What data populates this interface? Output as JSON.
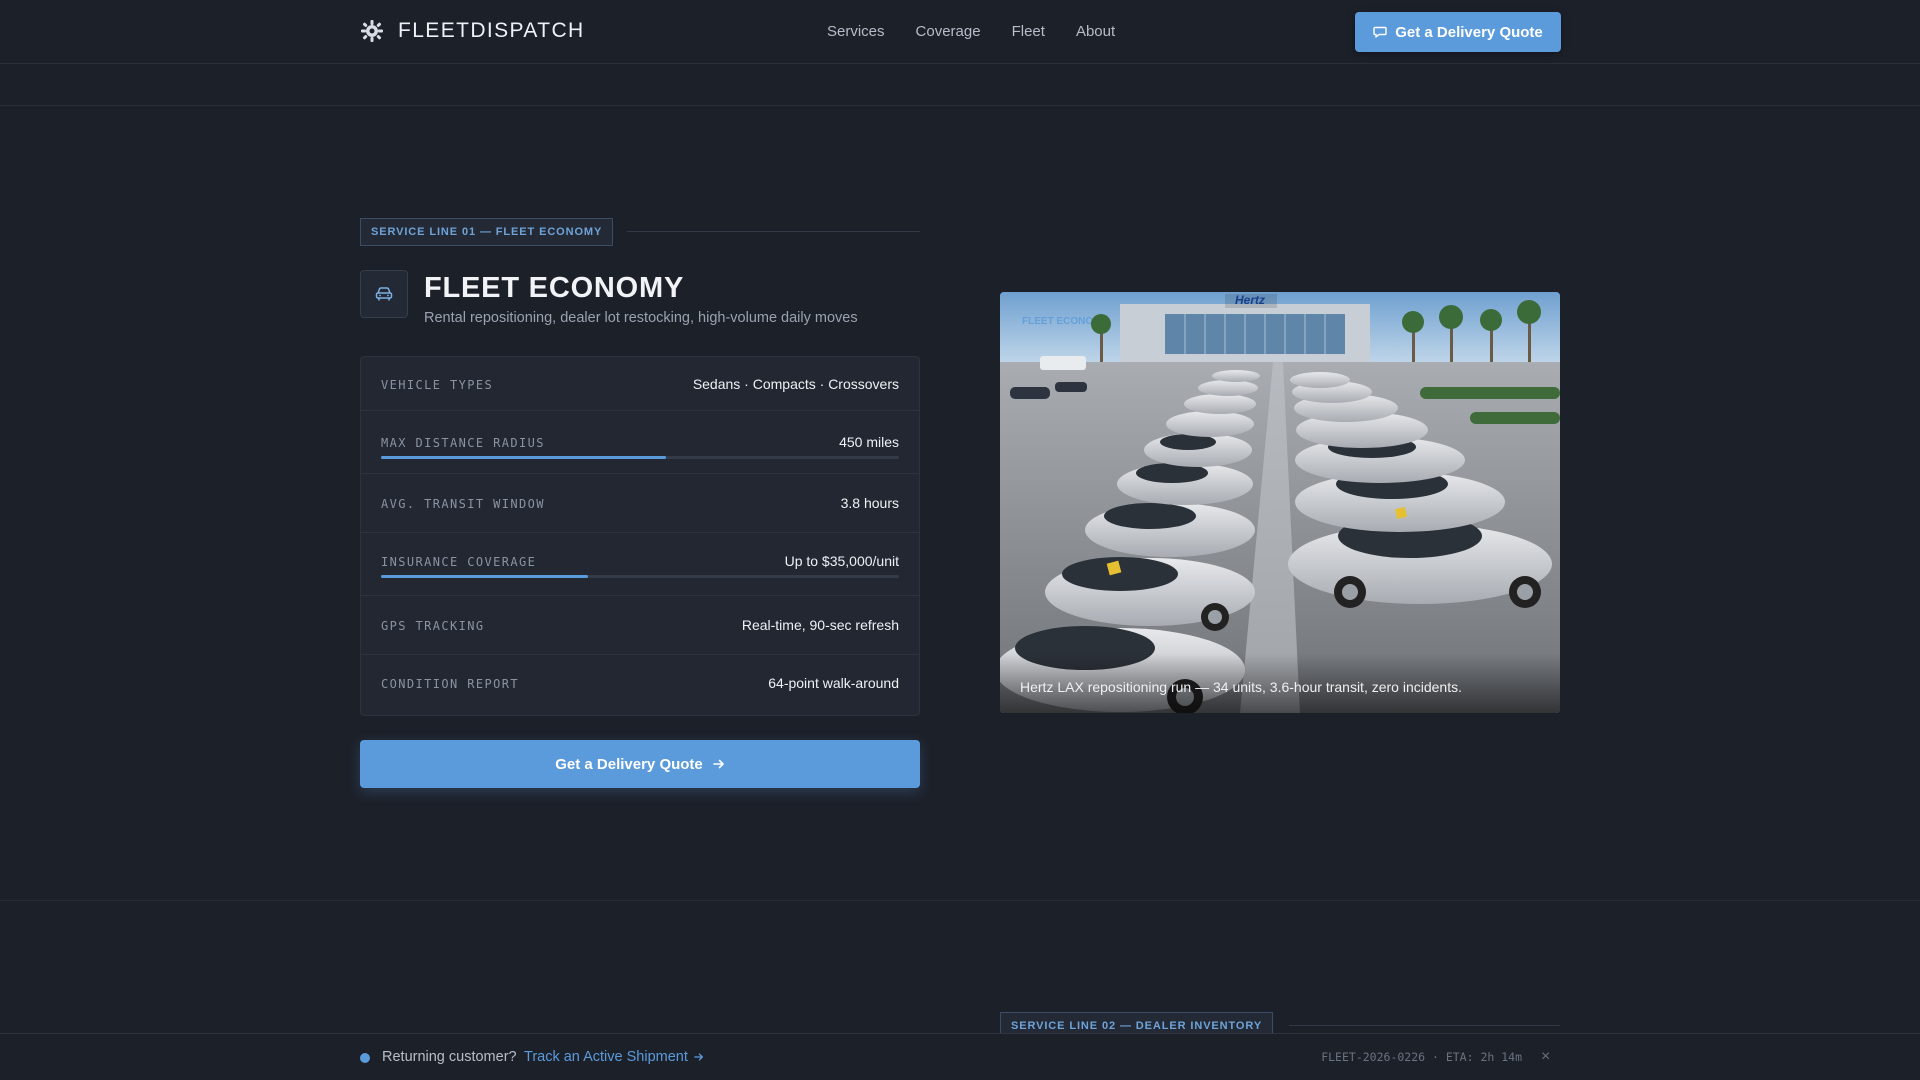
{
  "header": {
    "brand": "FLEETDISPATCH",
    "logo_icon": "gear-logo-icon",
    "nav": [
      "Services",
      "Coverage",
      "Fleet",
      "About"
    ],
    "cta_label": "Get a Delivery Quote",
    "cta_icon": "chat-bubble-icon"
  },
  "section": {
    "tag": "SERVICE LINE 01 — FLEET ECONOMY",
    "icon": "car-icon",
    "title": "FLEET ECONOMY",
    "subtitle": "Rental repositioning, dealer lot restocking, high-volume daily moves",
    "specs": [
      {
        "label": "VEHICLE TYPES",
        "value": "Sedans · Compacts · Crossovers"
      },
      {
        "label": "MAX DISTANCE RADIUS",
        "value": "450 miles",
        "bar_level": 0.55
      },
      {
        "label": "AVG. TRANSIT WINDOW",
        "value": "3.8 hours"
      },
      {
        "label": "INSURANCE COVERAGE",
        "value": "Up to $35,000/unit",
        "bar_level": 0.4
      },
      {
        "label": "GPS TRACKING",
        "value": "Real-time, 90-sec refresh"
      },
      {
        "label": "CONDITION REPORT",
        "value": "64-point walk-around"
      }
    ],
    "cta_label": "Get a Delivery Quote",
    "cta_icon": "arrow-right-icon",
    "photo": {
      "sign_text": "Hertz",
      "overlay_text": "FLEET ECONOMY",
      "caption": "Hertz LAX repositioning run — 34 units, 3.6-hour transit, zero incidents."
    }
  },
  "section2": {
    "tag": "SERVICE LINE 02 — DEALER INVENTORY"
  },
  "bottombar": {
    "text": "Returning customer?",
    "link": "Track an Active Shipment",
    "link_icon": "arrow-right-icon",
    "status": "FLEET-2026-0226 · ETA: 2h 14m",
    "close_icon": "close-icon",
    "close_glyph": "×"
  },
  "colors": {
    "background": "#1c2029",
    "accent": "#5b9bdc",
    "card": "#222732",
    "text": "#eef1f5",
    "muted": "#8b93a1"
  }
}
